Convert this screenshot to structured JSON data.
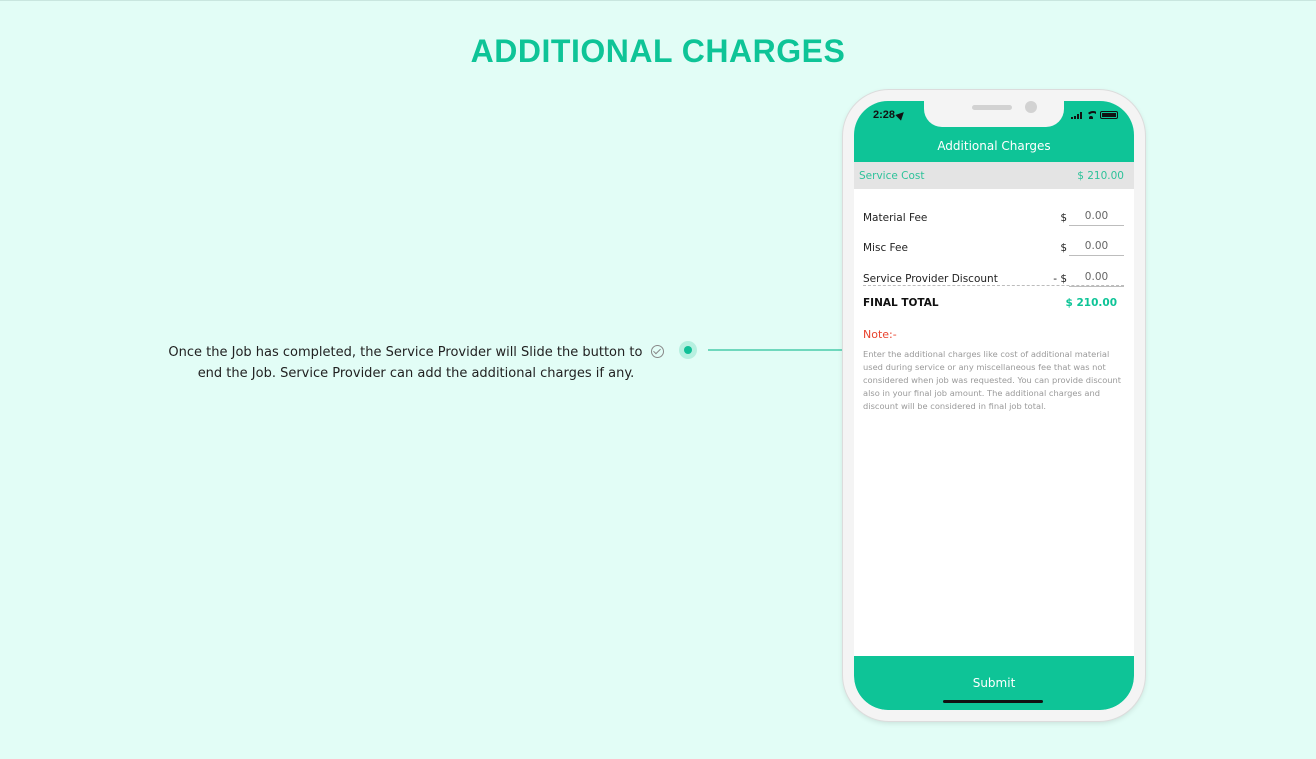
{
  "page": {
    "title": "ADDITIONAL CHARGES",
    "description": "Once the Job has completed, the Service Provider will Slide the button to",
    "description_line2": "end the Job. Service Provider can add the additional charges if any."
  },
  "colors": {
    "accent": "#0ec497",
    "title": "#0ec497",
    "background": "#e2fdf6",
    "note": "#e8432e"
  },
  "phone": {
    "status_time": "2:28",
    "header_title": "Additional Charges",
    "service_cost": {
      "label": "Service Cost",
      "value": "$ 210.00"
    },
    "fees": [
      {
        "label": "Material Fee",
        "currency": "$",
        "value": "0.00"
      },
      {
        "label": "Misc Fee",
        "currency": "$",
        "value": "0.00"
      },
      {
        "label": "Service Provider Discount",
        "currency": "- $",
        "value": "0.00"
      }
    ],
    "final_total": {
      "label": "FINAL TOTAL",
      "value": "$ 210.00"
    },
    "note_label": "Note:-",
    "note_text": "Enter the additional charges like cost of additional material used during service or any miscellaneous fee that was not considered when job was requested. You can provide discount also in your final job amount. The additional charges and discount will be considered in final job total.",
    "submit_label": "Submit"
  }
}
